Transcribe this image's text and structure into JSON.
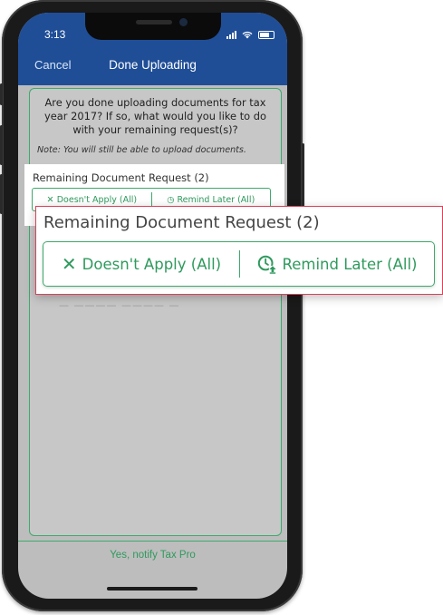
{
  "status_bar": {
    "time": "3:13"
  },
  "nav": {
    "cancel": "Cancel",
    "title": "Done Uploading"
  },
  "main": {
    "question": "Are you done uploading documents for tax year 2017? If so, what would you like to do with your remaining request(s)?",
    "note": "Note: You will still be able to upload documents.",
    "request_title": "Remaining Document Request (2)",
    "doesnt_apply": "Doesn't Apply (All)",
    "remind_later": "Remind Later (All)",
    "obscured_text": "— ———— ———— —"
  },
  "footer": {
    "notify_button": "Yes, notify Tax Pro"
  },
  "callout": {
    "title": "Remaining Document Request (2)",
    "doesnt_apply": "Doesn't Apply (All)",
    "remind_later": "Remind Later (All)"
  },
  "colors": {
    "nav_bar": "#1f4e97",
    "accent_green": "#2f9a5d",
    "border_green": "#3daa6b",
    "callout_border": "#d8435a",
    "overlay_grey": "#c7c7c7"
  },
  "icons": {
    "doesnt_apply": "close-x-icon",
    "remind_later": "clock-upload-icon"
  }
}
